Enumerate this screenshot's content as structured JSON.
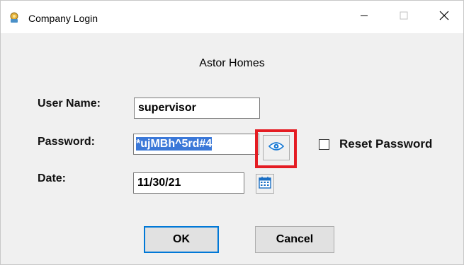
{
  "window": {
    "title": "Company Login"
  },
  "form": {
    "company_name": "Astor Homes",
    "username_label": "User Name:",
    "username_value": "supervisor",
    "password_label": "Password:",
    "password_value": "*ujMBh^5rd#4",
    "date_label": "Date:",
    "date_value": "11/30/21",
    "reset_password_label": "Reset Password",
    "reset_password_checked": false
  },
  "buttons": {
    "ok_label": "OK",
    "cancel_label": "Cancel"
  },
  "colors": {
    "highlight": "#e41c23",
    "selection": "#3b78d8",
    "accent": "#0078d7"
  },
  "icons": [
    "app-icon",
    "minimize-icon",
    "maximize-icon",
    "close-icon",
    "eye-icon",
    "calendar-icon"
  ]
}
